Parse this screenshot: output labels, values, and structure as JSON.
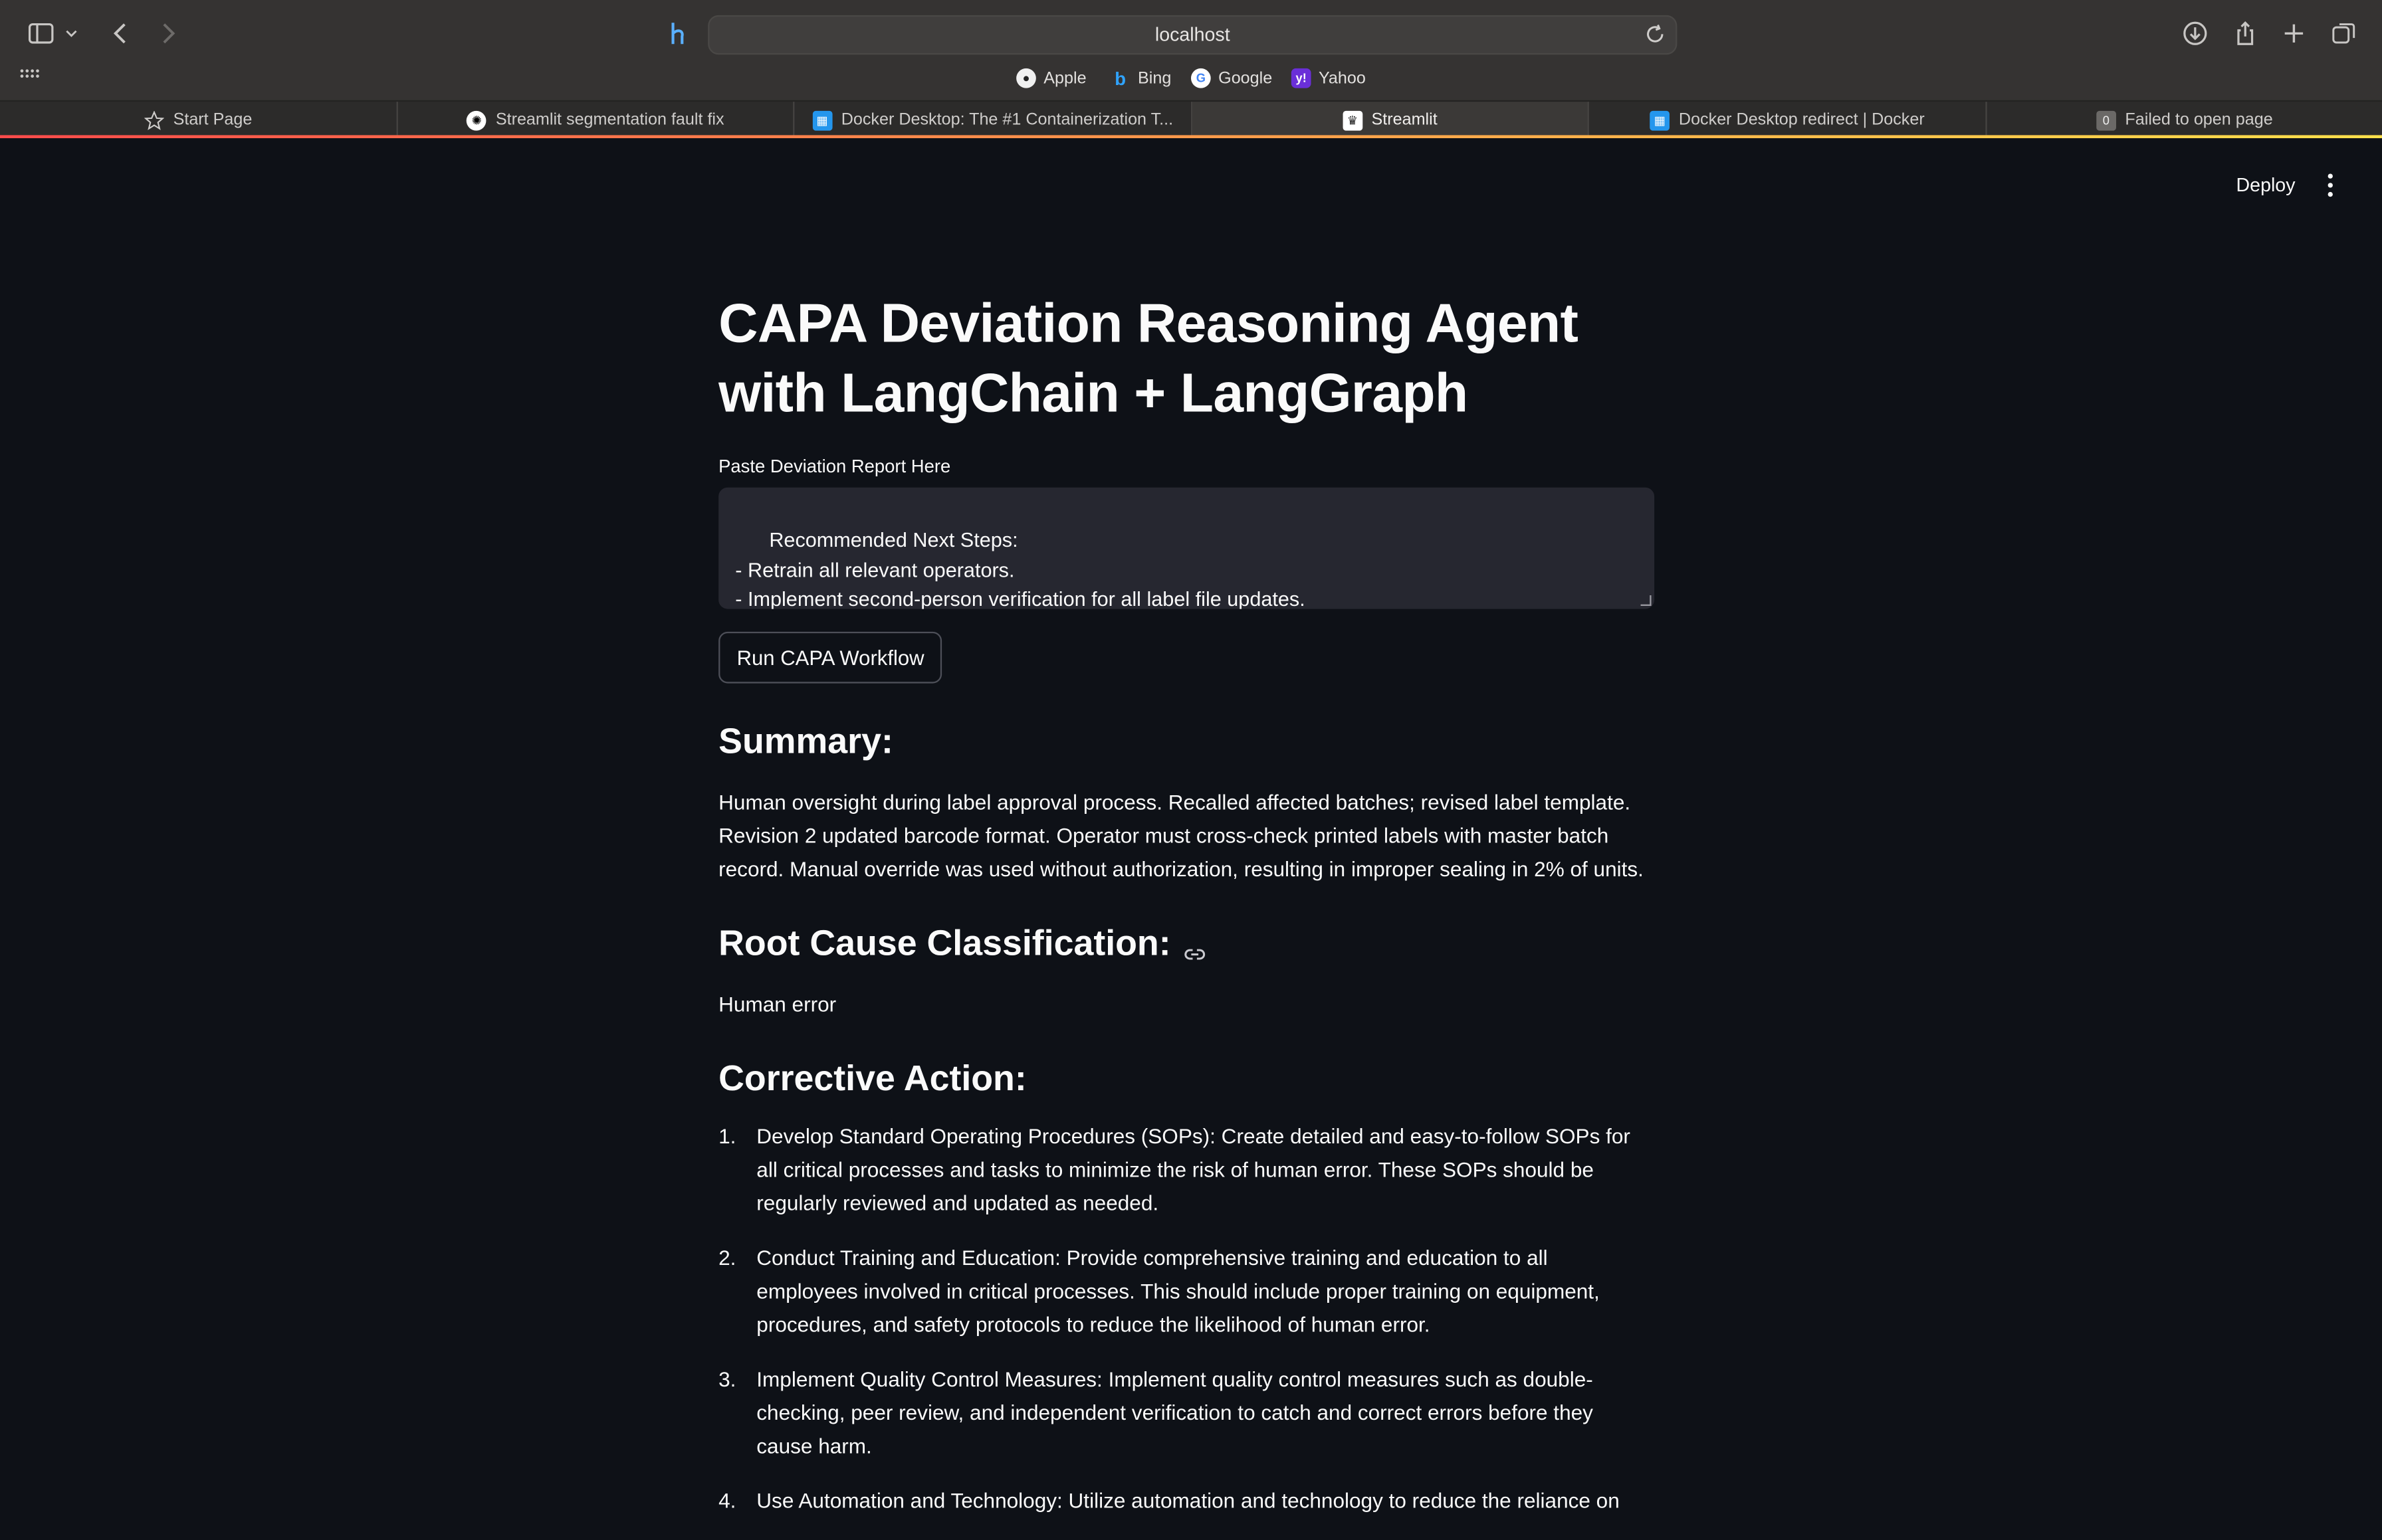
{
  "browser": {
    "url": "localhost",
    "favorites": [
      {
        "label": "Apple",
        "icon": "apple-icon"
      },
      {
        "label": "Bing",
        "icon": "bing-icon"
      },
      {
        "label": "Google",
        "icon": "google-icon"
      },
      {
        "label": "Yahoo",
        "icon": "yahoo-icon"
      }
    ],
    "tabs": [
      {
        "label": "Start Page",
        "icon": "star-icon"
      },
      {
        "label": "Streamlit segmentation fault fix",
        "icon": "openai-icon"
      },
      {
        "label": "Docker Desktop: The #1 Containerization T...",
        "icon": "docker-icon"
      },
      {
        "label": "Streamlit",
        "icon": "streamlit-icon",
        "active": true
      },
      {
        "label": "Docker Desktop redirect | Docker",
        "icon": "docker-icon"
      },
      {
        "label": "Failed to open page",
        "icon": "error-icon",
        "badge": "0"
      }
    ],
    "accent_colors": [
      "#ff4b4b",
      "#ffe14b"
    ]
  },
  "header": {
    "deploy_label": "Deploy"
  },
  "main": {
    "title": "CAPA Deviation Reasoning Agent with LangChain + LangGraph",
    "textarea_label": "Paste Deviation Report Here",
    "textarea_value": "Recommended Next Steps:\n- Retrain all relevant operators.\n- Implement second-person verification for all label file updates.\n- Schedule a refresher SOP review for labeling protocols.",
    "run_button": "Run CAPA Workflow",
    "summary_heading": "Summary:",
    "summary_text": "Human oversight during label approval process. Recalled affected batches; revised label template. Revision 2 updated barcode format. Operator must cross-check printed labels with master batch record. Manual override was used without authorization, resulting in improper sealing in 2% of units.",
    "root_cause_heading": "Root Cause Classification:",
    "root_cause_value": "Human error",
    "corrective_heading": "Corrective Action:",
    "corrective_actions": [
      {
        "num": "1.",
        "text": "Develop Standard Operating Procedures (SOPs): Create detailed and easy-to-follow SOPs for all critical processes and tasks to minimize the risk of human error. These SOPs should be regularly reviewed and updated as needed."
      },
      {
        "num": "2.",
        "text": "Conduct Training and Education: Provide comprehensive training and education to all employees involved in critical processes. This should include proper training on equipment, procedures, and safety protocols to reduce the likelihood of human error."
      },
      {
        "num": "3.",
        "text": "Implement Quality Control Measures: Implement quality control measures such as double-checking, peer review, and independent verification to catch and correct errors before they cause harm."
      },
      {
        "num": "4.",
        "text": "Use Automation and Technology: Utilize automation and technology to reduce the reliance on"
      }
    ],
    "theme": {
      "background": "#0e1117",
      "textarea_bg": "#262730",
      "text": "#fafafa"
    }
  }
}
